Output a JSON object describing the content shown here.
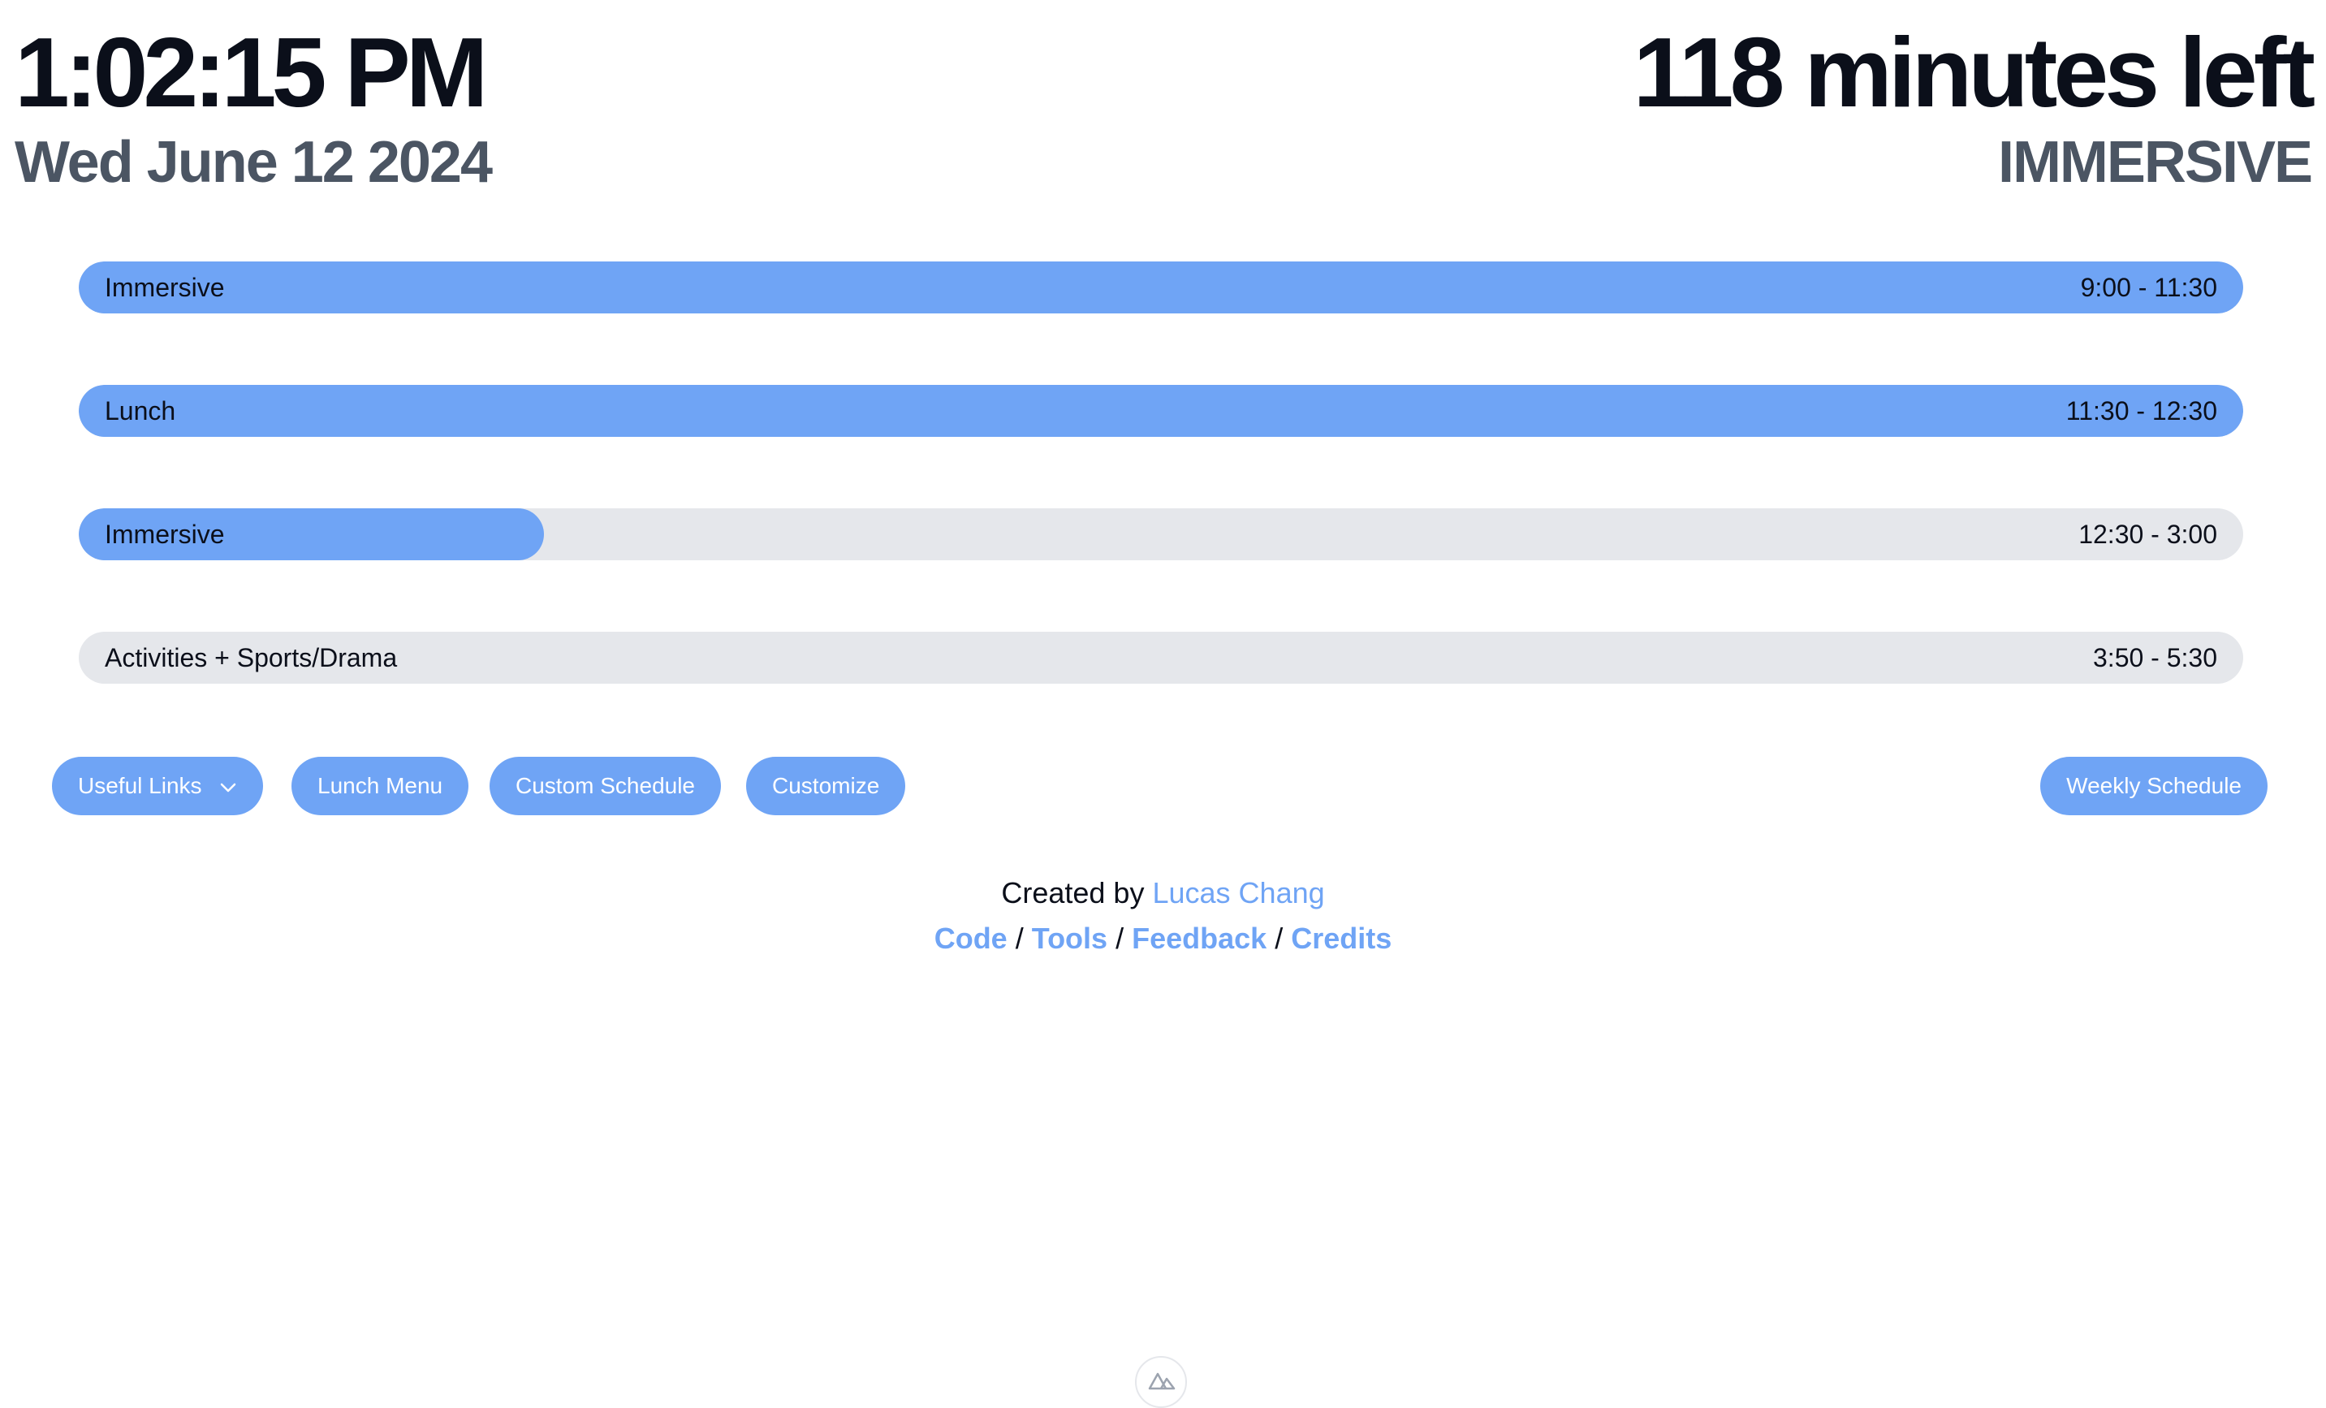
{
  "header": {
    "time": "1:02:15 PM",
    "date": "Wed June 12 2024",
    "remaining": "118 minutes left",
    "current_period": "IMMERSIVE"
  },
  "schedule": [
    {
      "name": "Immersive",
      "range": "9:00 - 11:30",
      "progress": 1.0
    },
    {
      "name": "Lunch",
      "range": "11:30 - 12:30",
      "progress": 1.0
    },
    {
      "name": "Immersive",
      "range": "12:30 - 3:00",
      "progress": 0.215
    },
    {
      "name": "Activities + Sports/Drama",
      "range": "3:50 - 5:30",
      "progress": 0.0
    }
  ],
  "toolbar": {
    "useful_links": "Useful Links",
    "lunch_menu": "Lunch Menu",
    "custom_schedule": "Custom Schedule",
    "customize": "Customize",
    "weekly_schedule": "Weekly Schedule"
  },
  "footer": {
    "created_by": "Created by",
    "author": "Lucas Chang",
    "links": [
      "Code",
      "Tools",
      "Feedback",
      "Credits"
    ],
    "separator": "/"
  },
  "colors": {
    "accent": "#6fa4f5",
    "track": "#e5e7eb",
    "text": "#0b0f1a",
    "subtext": "#4b5563"
  },
  "icons": {
    "dropdown": "chevron-down-icon",
    "badge": "nuxt-logo-icon"
  }
}
